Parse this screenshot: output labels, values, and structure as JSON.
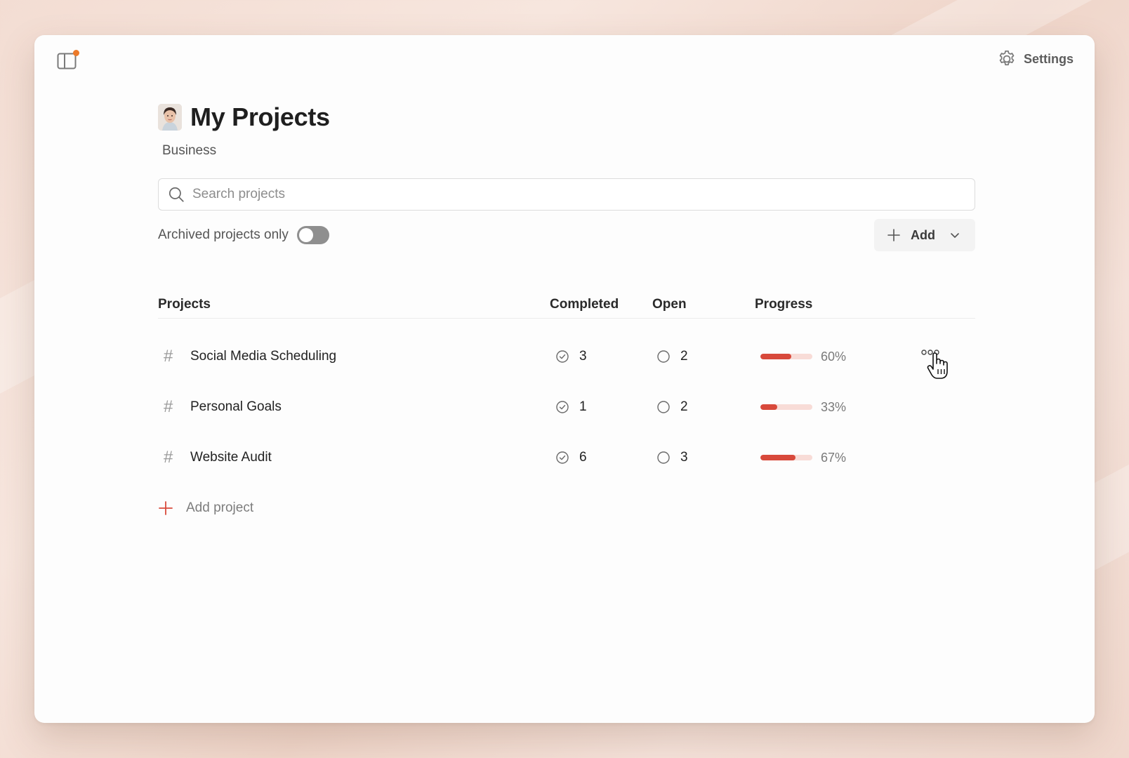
{
  "header": {
    "settings_label": "Settings"
  },
  "page": {
    "title": "My Projects",
    "workspace": "Business"
  },
  "search": {
    "placeholder": "Search projects",
    "value": ""
  },
  "filters": {
    "archived_label": "Archived projects only",
    "archived_on": false
  },
  "toolbar": {
    "add_label": "Add"
  },
  "table": {
    "headers": {
      "name": "Projects",
      "completed": "Completed",
      "open": "Open",
      "progress": "Progress"
    },
    "rows": [
      {
        "name": "Social Media Scheduling",
        "completed": "3",
        "open": "2",
        "progress": 0.6,
        "progress_label": "60%"
      },
      {
        "name": "Personal Goals",
        "completed": "1",
        "open": "2",
        "progress": 0.33,
        "progress_label": "33%"
      },
      {
        "name": "Website Audit",
        "completed": "6",
        "open": "3",
        "progress": 0.67,
        "progress_label": "67%"
      }
    ]
  },
  "add_project_label": "Add project",
  "colors": {
    "accent": "#d8493b",
    "progress_track": "#f8dcd7",
    "notification": "#ec7a2a"
  }
}
